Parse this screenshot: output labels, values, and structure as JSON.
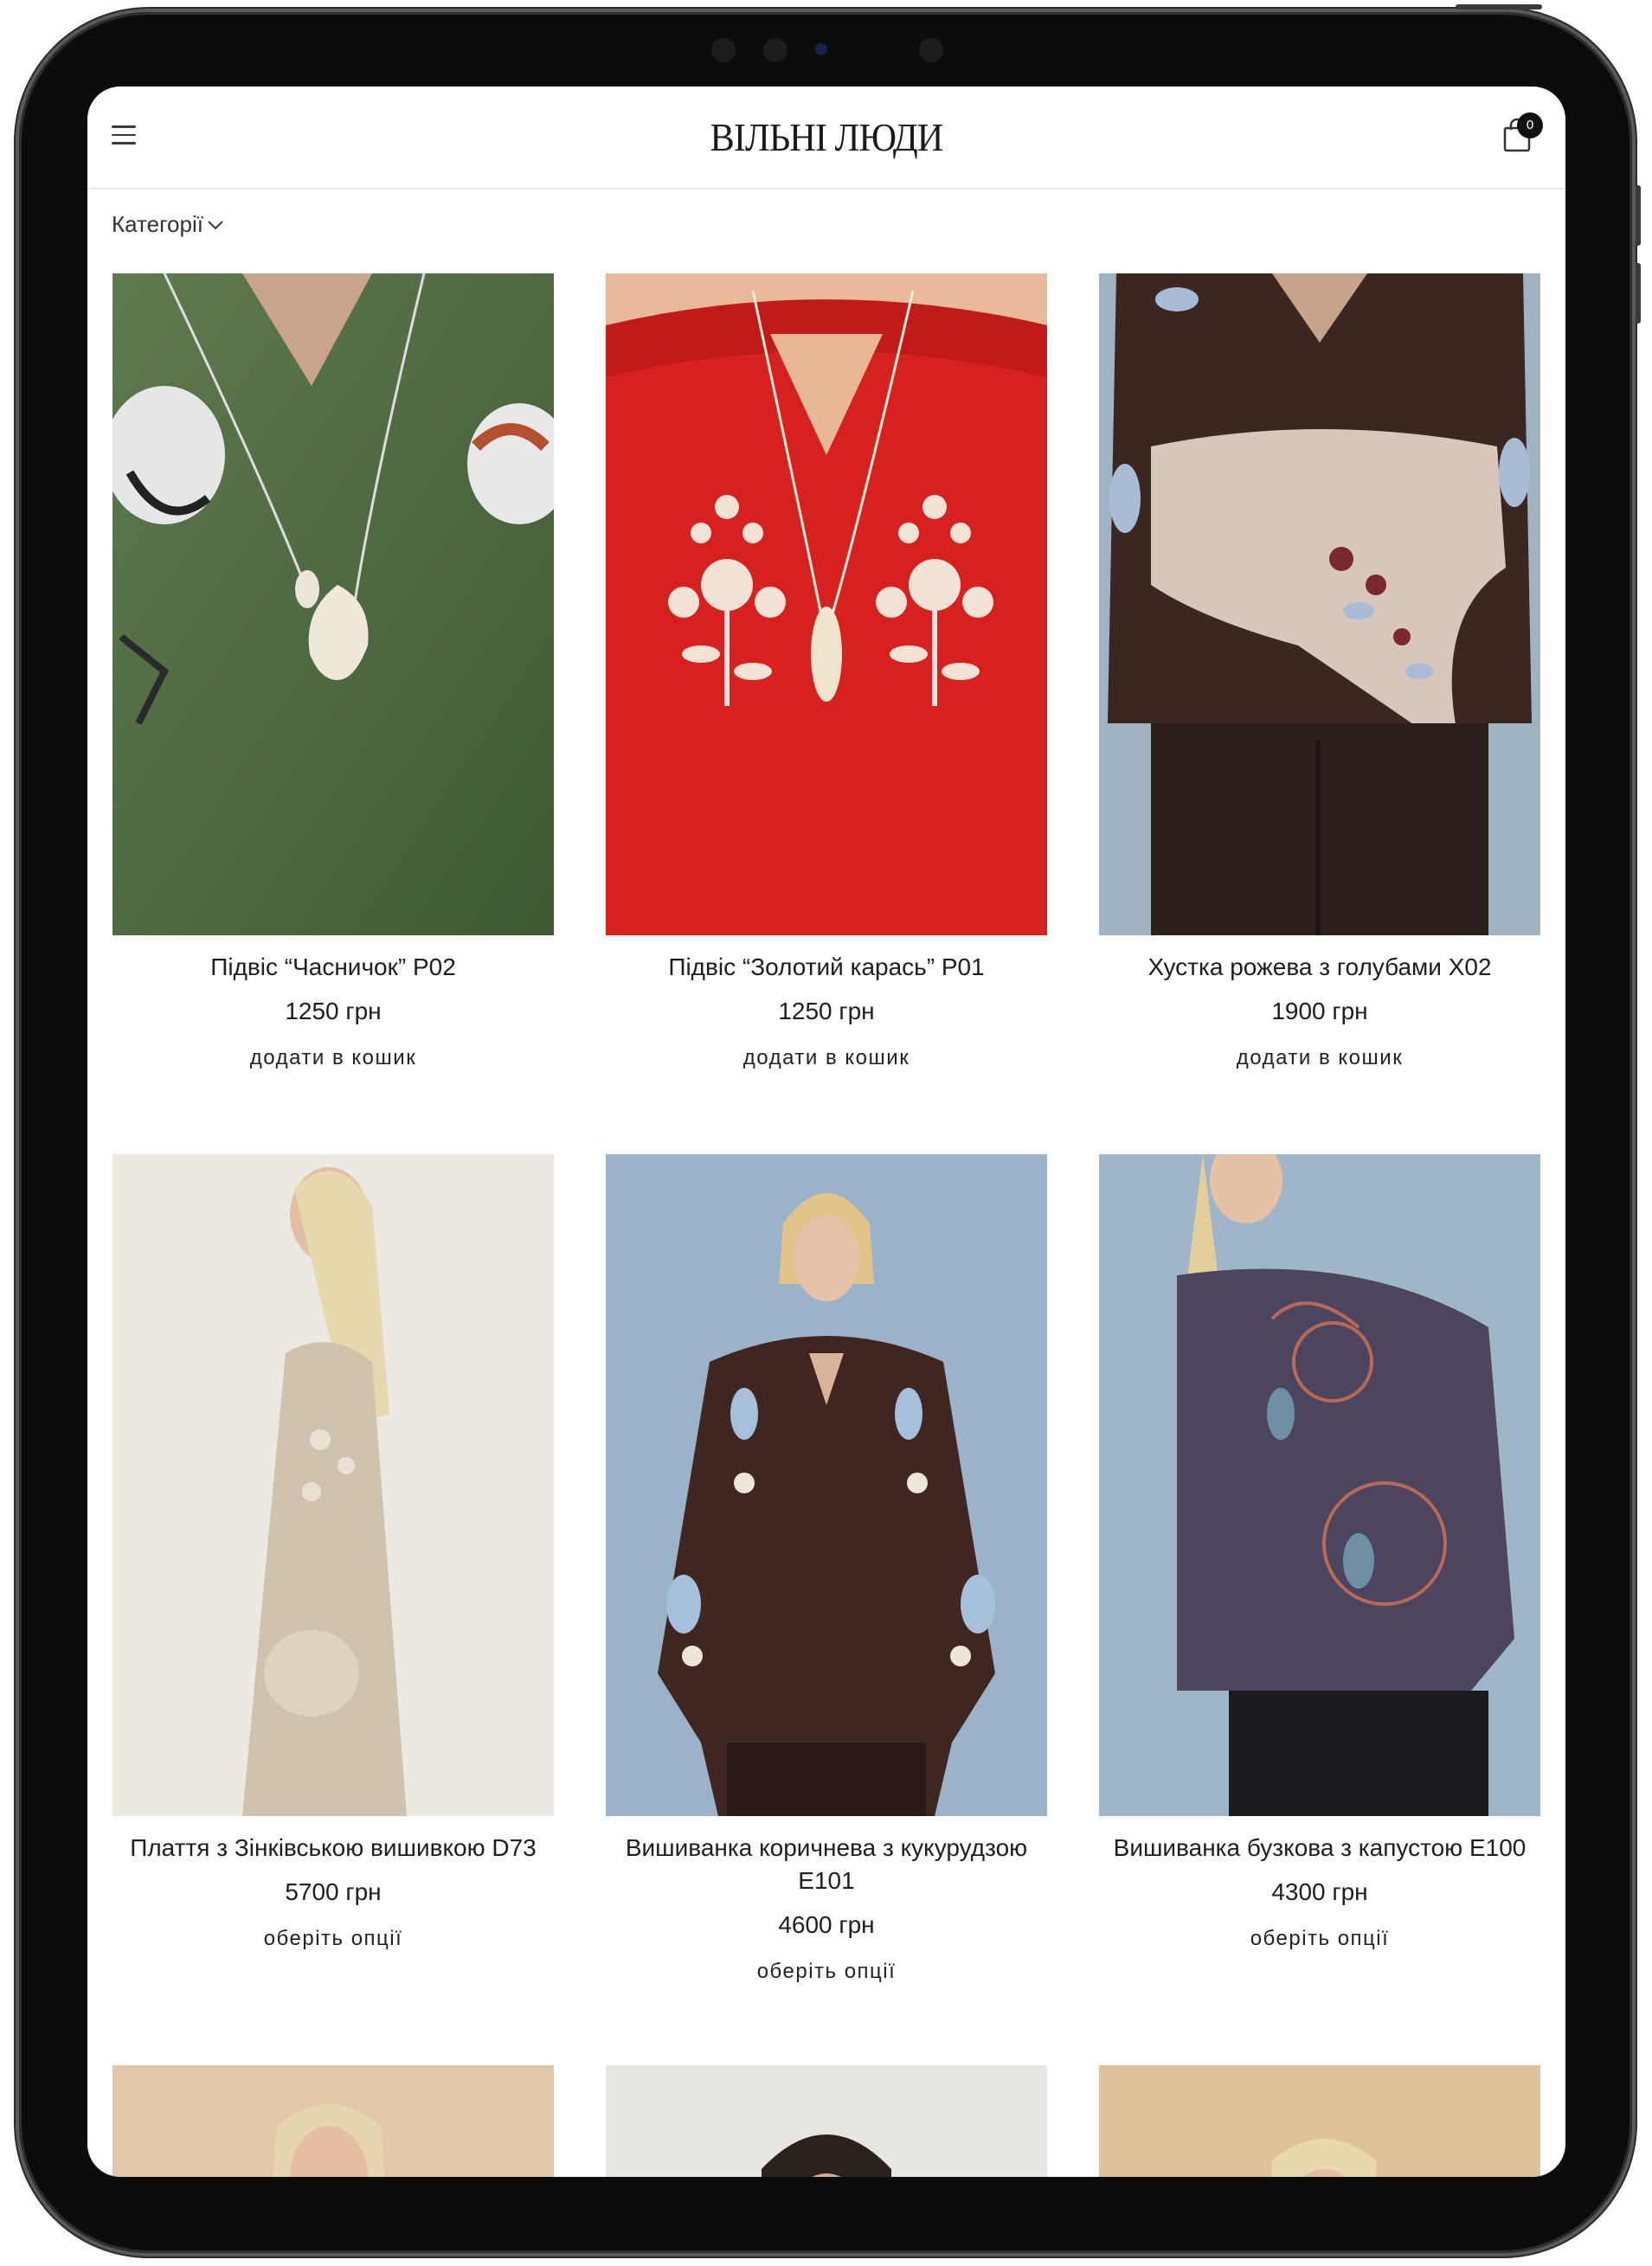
{
  "header": {
    "logo": "ВІЛЬНІ ЛЮДИ",
    "cart_count": "0"
  },
  "filter": {
    "categories_label": "Категорії"
  },
  "colors": {
    "text": "#1e1e1e",
    "frame": "#0c0c0c"
  },
  "products": [
    {
      "title": "Підвіс “Часничок” P02",
      "price": "1250 грн",
      "action": "додати в кошик"
    },
    {
      "title": "Підвіс “Золотий карась” P01",
      "price": "1250 грн",
      "action": "додати в кошик"
    },
    {
      "title": "Хустка рожева з голубами X02",
      "price": "1900 грн",
      "action": "додати в кошик"
    },
    {
      "title": "Плаття з Зінківською вишивкою D73",
      "price": "5700 грн",
      "action": "оберіть опції"
    },
    {
      "title": "Вишиванка коричнева з кукурудзою E101",
      "price": "4600 грн",
      "action": "оберіть опції"
    },
    {
      "title": "Вишиванка бузкова з капустою E100",
      "price": "4300 грн",
      "action": "оберіть опції"
    }
  ]
}
